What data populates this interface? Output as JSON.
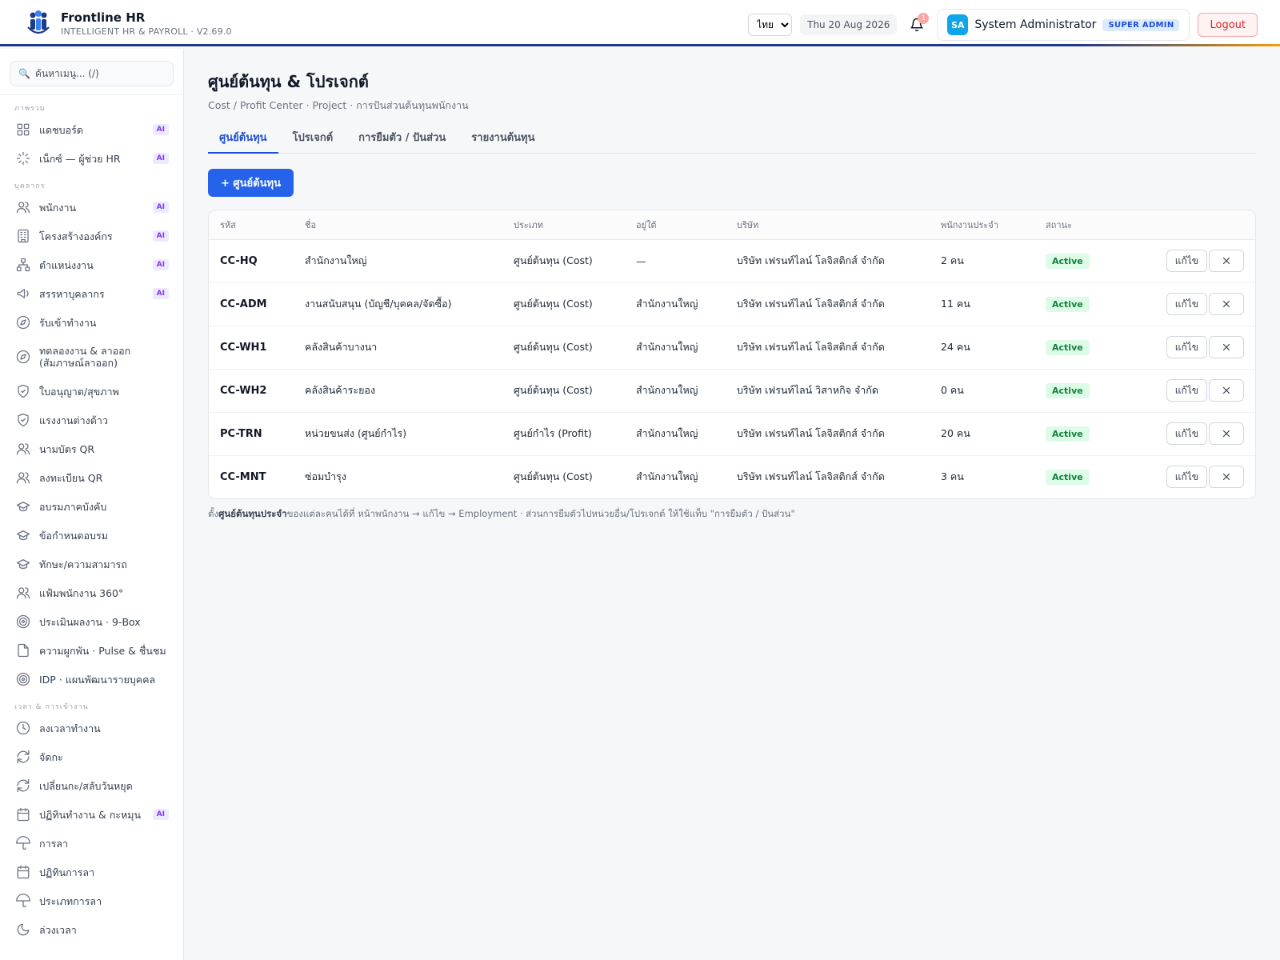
{
  "app": {
    "name": "Frontline HR",
    "subtitle": "INTELLIGENT HR & PAYROLL · V2.69.0"
  },
  "header": {
    "language": "ไทย",
    "date": "Thu 20 Aug 2026",
    "notification_count": "1",
    "user_initials": "SA",
    "user_name": "System Administrator",
    "user_role": "SUPER ADMIN",
    "logout_label": "Logout"
  },
  "sidebar": {
    "search_placeholder": "ค้นหาเมนู... (/)",
    "sections": [
      {
        "title": "ภาพรวม",
        "items": [
          {
            "label": "แดชบอร์ด",
            "icon": "grid-icon",
            "ai": true
          },
          {
            "label": "เน็กซ์ — ผู้ช่วย HR",
            "icon": "sparkle-icon",
            "ai": true
          }
        ]
      },
      {
        "title": "บุคลากร",
        "items": [
          {
            "label": "พนักงาน",
            "icon": "users-icon",
            "ai": true
          },
          {
            "label": "โครงสร้างองค์กร",
            "icon": "building-icon",
            "ai": true
          },
          {
            "label": "ตำแหน่งงาน",
            "icon": "org-chart-icon",
            "ai": true
          },
          {
            "label": "สรรหาบุคลากร",
            "icon": "megaphone-icon",
            "ai": true
          },
          {
            "label": "รับเข้าทำงาน",
            "icon": "compass-icon",
            "ai": false
          },
          {
            "label": "ทดลองงาน & ลาออก (สัมภาษณ์ลาออก)",
            "icon": "compass-icon",
            "ai": false,
            "tall": true
          },
          {
            "label": "ใบอนุญาต/สุขภาพ",
            "icon": "shield-icon",
            "ai": false
          },
          {
            "label": "แรงงานต่างด้าว",
            "icon": "shield-icon",
            "ai": false
          },
          {
            "label": "นามบัตร QR",
            "icon": "users-icon",
            "ai": false
          },
          {
            "label": "ลงทะเบียน QR",
            "icon": "users-icon",
            "ai": false
          },
          {
            "label": "อบรมภาคบังคับ",
            "icon": "graduation-cap-icon",
            "ai": false
          },
          {
            "label": "ข้อกำหนดอบรม",
            "icon": "graduation-cap-icon",
            "ai": false
          },
          {
            "label": "ทักษะ/ความสามารถ",
            "icon": "graduation-cap-icon",
            "ai": false
          },
          {
            "label": "แฟ้มพนักงาน 360°",
            "icon": "users-icon",
            "ai": false
          },
          {
            "label": "ประเมินผลงาน · 9-Box",
            "icon": "target-icon",
            "ai": false
          },
          {
            "label": "ความผูกพัน · Pulse & ชื่นชม",
            "icon": "document-icon",
            "ai": false
          },
          {
            "label": "IDP · แผนพัฒนารายบุคคล",
            "icon": "target-icon",
            "ai": false
          }
        ]
      },
      {
        "title": "เวลา & การเข้างาน",
        "items": [
          {
            "label": "ลงเวลาทำงาน",
            "icon": "clock-icon",
            "ai": false
          },
          {
            "label": "จัดกะ",
            "icon": "refresh-icon",
            "ai": false
          },
          {
            "label": "เปลี่ยนกะ/สลับวันหยุด",
            "icon": "refresh-icon",
            "ai": false
          },
          {
            "label": "ปฏิทินทำงาน & กะหมุน",
            "icon": "calendar-icon",
            "ai": true
          },
          {
            "label": "การลา",
            "icon": "umbrella-icon",
            "ai": false
          },
          {
            "label": "ปฏิทินการลา",
            "icon": "calendar-icon",
            "ai": false
          },
          {
            "label": "ประเภทการลา",
            "icon": "umbrella-icon",
            "ai": false
          },
          {
            "label": "ล่วงเวลา",
            "icon": "moon-icon",
            "ai": false
          }
        ]
      }
    ],
    "ai_label": "AI"
  },
  "main": {
    "title": "ศูนย์ต้นทุน & โปรเจกต์",
    "subtitle": "Cost / Profit Center · Project · การปันส่วนต้นทุนพนักงาน",
    "tabs": [
      "ศูนย์ต้นทุน",
      "โปรเจกต์",
      "การยืมตัว / ปันส่วน",
      "รายงานต้นทุน"
    ],
    "active_tab": 0,
    "add_button": "+ ศูนย์ต้นทุน",
    "table": {
      "columns": [
        "รหัส",
        "ชื่อ",
        "ประเภท",
        "อยู่ใต้",
        "บริษัท",
        "พนักงานประจำ",
        "สถานะ"
      ],
      "edit_label": "แก้ไข",
      "rows": [
        {
          "code": "CC-HQ",
          "name": "สำนักงานใหญ่",
          "type": "ศูนย์ต้นทุน (Cost)",
          "parent": "—",
          "company": "บริษัท เฟรนท์ไลน์ โลจิสติกส์ จำกัด",
          "staff": "2 คน",
          "status": "Active"
        },
        {
          "code": "CC-ADM",
          "name": "งานสนับสนุน (บัญชี/บุคคล/จัดซื้อ)",
          "type": "ศูนย์ต้นทุน (Cost)",
          "parent": "สำนักงานใหญ่",
          "company": "บริษัท เฟรนท์ไลน์ โลจิสติกส์ จำกัด",
          "staff": "11 คน",
          "status": "Active"
        },
        {
          "code": "CC-WH1",
          "name": "คลังสินค้าบางนา",
          "type": "ศูนย์ต้นทุน (Cost)",
          "parent": "สำนักงานใหญ่",
          "company": "บริษัท เฟรนท์ไลน์ โลจิสติกส์ จำกัด",
          "staff": "24 คน",
          "status": "Active"
        },
        {
          "code": "CC-WH2",
          "name": "คลังสินค้าระยอง",
          "type": "ศูนย์ต้นทุน (Cost)",
          "parent": "สำนักงานใหญ่",
          "company": "บริษัท เฟรนท์ไลน์ วิสาหกิจ จำกัด",
          "staff": "0 คน",
          "status": "Active"
        },
        {
          "code": "PC-TRN",
          "name": "หน่วยขนส่ง (ศูนย์กำไร)",
          "type": "ศูนย์กำไร (Profit)",
          "parent": "สำนักงานใหญ่",
          "company": "บริษัท เฟรนท์ไลน์ โลจิสติกส์ จำกัด",
          "staff": "20 คน",
          "status": "Active"
        },
        {
          "code": "CC-MNT",
          "name": "ซ่อมบำรุง",
          "type": "ศูนย์ต้นทุน (Cost)",
          "parent": "สำนักงานใหญ่",
          "company": "บริษัท เฟรนท์ไลน์ โลจิสติกส์ จำกัด",
          "staff": "3 คน",
          "status": "Active"
        }
      ]
    },
    "footnote_prefix": "ตั้ง",
    "footnote_bold": "ศูนย์ต้นทุนประจำ",
    "footnote_rest": "ของแต่ละคนได้ที่ หน้าพนักงาน → แก้ไข → Employment · ส่วนการยืมตัวไปหน่วยอื่น/โปรเจกต์ ให้ใช้แท็บ \"การยืมตัว / ปันส่วน\""
  },
  "colors": {
    "primary": "#2563eb",
    "header_border": "#1e3a8a",
    "status_active_bg": "#dcfce7",
    "status_active_text": "#15803d",
    "ai_badge": "#7c3aed"
  }
}
